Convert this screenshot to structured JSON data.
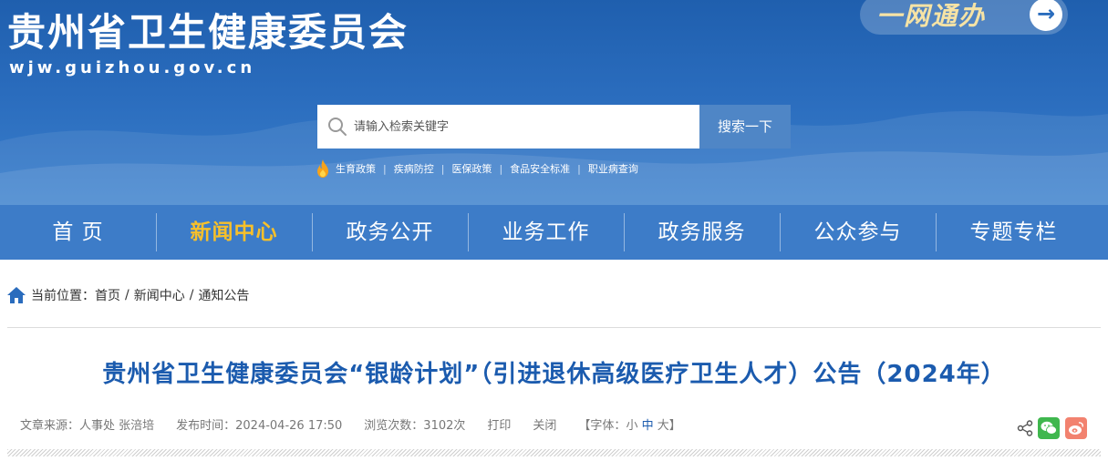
{
  "header": {
    "site_title": "贵州省卫生健康委员会",
    "site_url": "wjw.guizhou.gov.cn",
    "one_net_label": "一网通办"
  },
  "search": {
    "placeholder": "请输入检索关键字",
    "button_label": "搜索一下"
  },
  "hot_links": [
    "生育政策",
    "疾病防控",
    "医保政策",
    "食品安全标准",
    "职业病查询"
  ],
  "nav": {
    "items": [
      "首 页",
      "新闻中心",
      "政务公开",
      "业务工作",
      "政务服务",
      "公众参与",
      "专题专栏"
    ],
    "active_index": 1
  },
  "breadcrumb": {
    "prefix": "当前位置：",
    "items": [
      "首页",
      "新闻中心",
      "通知公告"
    ],
    "separator": "/"
  },
  "article": {
    "title": "贵州省卫生健康委员会“银龄计划”（引进退休高级医疗卫生人才）公告（2024年）",
    "meta": {
      "source": "文章来源：人事处 张涪培",
      "publish_time": "发布时间：2024-04-26 17:50",
      "views": "浏览次数：3102次",
      "print_label": "打印",
      "close_label": "关闭",
      "font_prefix": "【字体：",
      "font_small": "小",
      "font_medium": "中",
      "font_large": "大",
      "font_suffix": "】"
    }
  },
  "colors": {
    "header_blue": "#2a6cbd",
    "nav_blue": "#3d7cc8",
    "active_nav": "#f7c02a",
    "title_blue": "#1b5bae",
    "wechat_green": "#3fb74e",
    "weibo_red": "#f2826f"
  },
  "icons": [
    "search-icon",
    "flame-icon",
    "home-icon",
    "share-icon",
    "wechat-icon",
    "weibo-icon",
    "arrow-right-icon"
  ]
}
